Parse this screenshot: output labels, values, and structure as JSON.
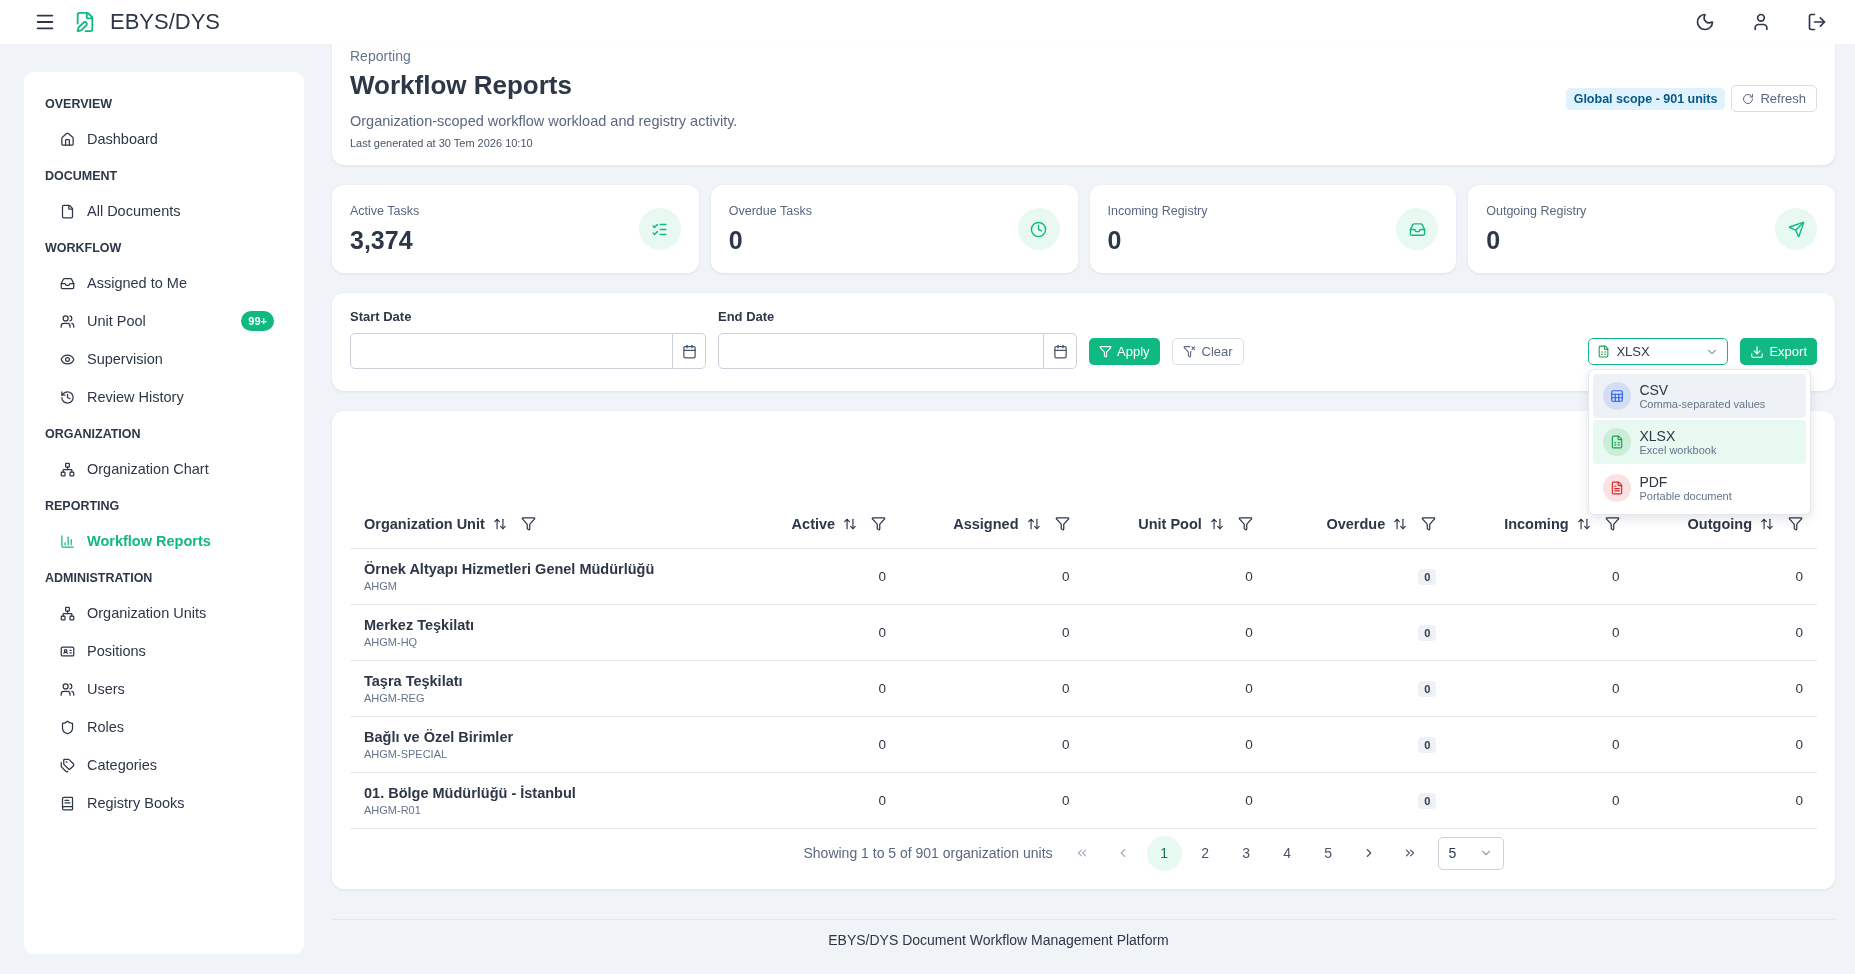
{
  "app": {
    "title": "EBYS/DYS"
  },
  "sidebar": {
    "sections": [
      {
        "title": "OVERVIEW",
        "items": [
          {
            "label": "Dashboard",
            "selected": false
          }
        ]
      },
      {
        "title": "DOCUMENT",
        "items": [
          {
            "label": "All Documents",
            "selected": false
          }
        ]
      },
      {
        "title": "WORKFLOW",
        "items": [
          {
            "label": "Assigned to Me",
            "selected": false
          },
          {
            "label": "Unit Pool",
            "selected": false,
            "badge": "99+"
          },
          {
            "label": "Supervision",
            "selected": false
          },
          {
            "label": "Review History",
            "selected": false
          }
        ]
      },
      {
        "title": "ORGANIZATION",
        "items": [
          {
            "label": "Organization Chart",
            "selected": false
          }
        ]
      },
      {
        "title": "REPORTING",
        "items": [
          {
            "label": "Workflow Reports",
            "selected": true
          }
        ]
      },
      {
        "title": "ADMINISTRATION",
        "items": [
          {
            "label": "Organization Units",
            "selected": false
          },
          {
            "label": "Positions",
            "selected": false
          },
          {
            "label": "Users",
            "selected": false
          },
          {
            "label": "Roles",
            "selected": false
          },
          {
            "label": "Categories",
            "selected": false
          },
          {
            "label": "Registry Books",
            "selected": false
          }
        ]
      }
    ]
  },
  "page": {
    "breadcrumb": "Reporting",
    "title": "Workflow Reports",
    "subtitle": "Organization-scoped workflow workload and registry activity.",
    "generated": "Last generated at 30 Tem 2026 10:10",
    "scope_badge": "Global scope - 901 units",
    "refresh_button": "Refresh"
  },
  "stats": [
    {
      "label": "Active Tasks",
      "value": "3,374"
    },
    {
      "label": "Overdue Tasks",
      "value": "0"
    },
    {
      "label": "Incoming Registry",
      "value": "0"
    },
    {
      "label": "Outgoing Registry",
      "value": "0"
    }
  ],
  "filters": {
    "start_date": {
      "label": "Start Date"
    },
    "end_date": {
      "label": "End Date"
    },
    "apply_button": "Apply",
    "clear_button": "Clear",
    "format_select": {
      "value": "XLSX",
      "expanded": true,
      "options": [
        {
          "label": "CSV",
          "description": "Comma-separated values",
          "selected": false,
          "highlighted": true,
          "color": "#2563eb"
        },
        {
          "label": "XLSX",
          "description": "Excel workbook",
          "selected": true,
          "highlighted": false,
          "color": "#16a34a"
        },
        {
          "label": "PDF",
          "description": "Portable document",
          "selected": false,
          "highlighted": false,
          "color": "#dc2626"
        }
      ]
    },
    "export_button": "Export"
  },
  "table": {
    "columns": [
      {
        "label": "Organization Unit",
        "kind": "unit"
      },
      {
        "label": "Active",
        "kind": "number"
      },
      {
        "label": "Assigned",
        "kind": "number"
      },
      {
        "label": "Unit Pool",
        "kind": "number"
      },
      {
        "label": "Overdue",
        "kind": "badge"
      },
      {
        "label": "Incoming",
        "kind": "number"
      },
      {
        "label": "Outgoing",
        "kind": "number"
      }
    ],
    "rows": [
      {
        "name": "Örnek Altyapı Hizmetleri Genel Müdürlüğü",
        "code": "AHGM",
        "values": [
          "0",
          "0",
          "0",
          "0",
          "0",
          "0"
        ]
      },
      {
        "name": "Merkez Teşkilatı",
        "code": "AHGM-HQ",
        "values": [
          "0",
          "0",
          "0",
          "0",
          "0",
          "0"
        ]
      },
      {
        "name": "Taşra Teşkilatı",
        "code": "AHGM-REG",
        "values": [
          "0",
          "0",
          "0",
          "0",
          "0",
          "0"
        ]
      },
      {
        "name": "Bağlı ve Özel Birimler",
        "code": "AHGM-SPECIAL",
        "values": [
          "0",
          "0",
          "0",
          "0",
          "0",
          "0"
        ]
      },
      {
        "name": "01. Bölge Müdürlüğü - İstanbul",
        "code": "AHGM-R01",
        "values": [
          "0",
          "0",
          "0",
          "0",
          "0",
          "0"
        ]
      }
    ]
  },
  "pagination": {
    "summary": "Showing 1 to 5 of 901 organization units",
    "pages": [
      {
        "label": "1",
        "selected": true
      },
      {
        "label": "2",
        "selected": false
      },
      {
        "label": "3",
        "selected": false
      },
      {
        "label": "4",
        "selected": false
      },
      {
        "label": "5",
        "selected": false
      }
    ],
    "page_size": "5"
  },
  "footer": "EBYS/DYS Document Workflow Management Platform"
}
